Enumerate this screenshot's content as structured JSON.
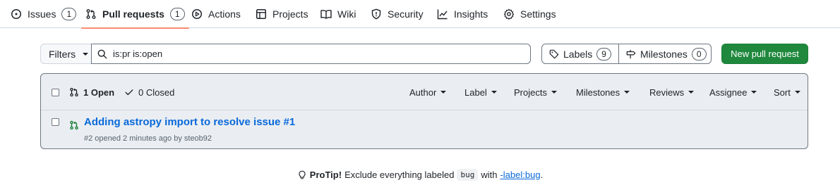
{
  "repo_nav": {
    "tabs": [
      {
        "label": "Issues",
        "icon": "issue-opened-icon",
        "counter": "1"
      },
      {
        "label": "Pull requests",
        "icon": "git-pull-request-icon",
        "counter": "1",
        "selected": true
      },
      {
        "label": "Actions",
        "icon": "play-icon"
      },
      {
        "label": "Projects",
        "icon": "table-icon"
      },
      {
        "label": "Wiki",
        "icon": "book-icon"
      },
      {
        "label": "Security",
        "icon": "shield-icon"
      },
      {
        "label": "Insights",
        "icon": "graph-icon"
      },
      {
        "label": "Settings",
        "icon": "gear-icon"
      }
    ]
  },
  "filter_bar": {
    "filters_label": "Filters",
    "search_value": "is:pr is:open",
    "labels_label": "Labels",
    "labels_count": "9",
    "milestones_label": "Milestones",
    "milestones_count": "0",
    "new_pr_label": "New pull request"
  },
  "list_header": {
    "open_label": "1 Open",
    "closed_label": "0 Closed",
    "filters": [
      "Author",
      "Label",
      "Projects",
      "Milestones",
      "Reviews",
      "Assignee",
      "Sort"
    ]
  },
  "pull_requests": [
    {
      "title": "Adding astropy import to resolve issue #1",
      "meta": "#2 opened 2 minutes ago by steob92"
    }
  ],
  "protip": {
    "lead": "ProTip!",
    "text_before": "Exclude everything labeled",
    "code": "bug",
    "text_mid": "with",
    "link": "-label:bug",
    "text_after": "."
  },
  "colors": {
    "accent_link": "#0969da",
    "primary_button": "#1f883d",
    "selected_tab_underline": "#fd8c73",
    "open_icon": "#1a7f37"
  }
}
